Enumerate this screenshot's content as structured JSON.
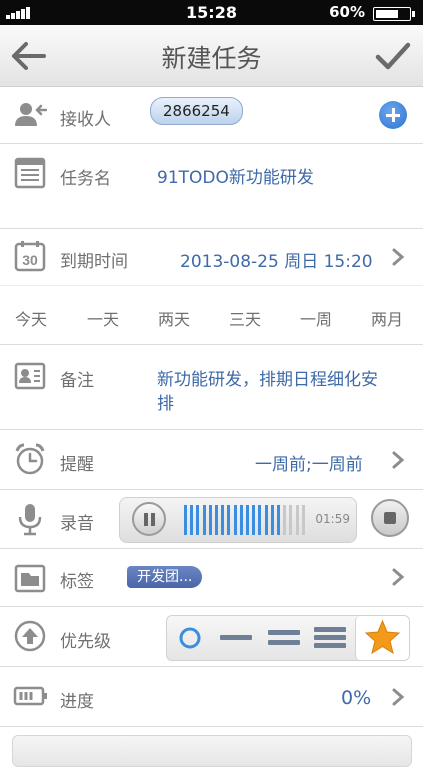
{
  "status_bar": {
    "time": "15:28",
    "battery_percent": "60%"
  },
  "nav": {
    "title": "新建任务"
  },
  "receiver": {
    "label": "接收人",
    "contact": "2866254"
  },
  "task_name": {
    "label": "任务名",
    "value": "91TODO新功能研发"
  },
  "due": {
    "label": "到期时间",
    "value": "2013-08-25 周日 15:20",
    "quick_options": [
      "今天",
      "一天",
      "两天",
      "三天",
      "一周",
      "两月"
    ]
  },
  "note": {
    "label": "备注",
    "value_line1": "新功能研发，排期日程细化安",
    "value_line2": "排"
  },
  "reminder": {
    "label": "提醒",
    "value": "一周前;一周前"
  },
  "recording": {
    "label": "录音",
    "duration": "01:59"
  },
  "tags": {
    "label": "标签",
    "value": "开发团..."
  },
  "priority": {
    "label": "优先级",
    "options": [
      "none",
      "low",
      "medium",
      "high",
      "star"
    ],
    "selected": "star"
  },
  "progress": {
    "label": "进度",
    "value": "0%"
  },
  "colors": {
    "value_text": "#3e6aa8",
    "wave_played": "#3b8de0",
    "wave_unplayed": "#c8c8c8",
    "star": "#f39a1a"
  }
}
